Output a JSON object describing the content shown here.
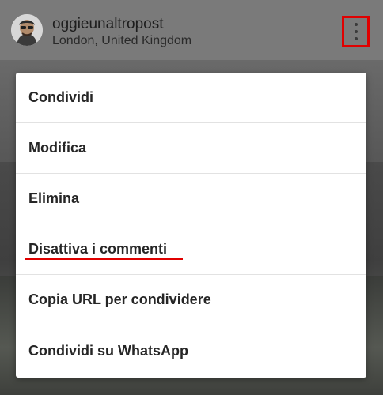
{
  "header": {
    "username": "oggieunaltropost",
    "location": "London, United Kingdom",
    "more_icon": "more-vertical-icon",
    "highlight_color": "#e00000"
  },
  "menu": {
    "items": [
      {
        "label": "Condividi"
      },
      {
        "label": "Modifica"
      },
      {
        "label": "Elimina"
      },
      {
        "label": "Disattiva i commenti",
        "underlined": true
      },
      {
        "label": "Copia URL per condividere"
      },
      {
        "label": "Condividi su WhatsApp"
      }
    ]
  }
}
